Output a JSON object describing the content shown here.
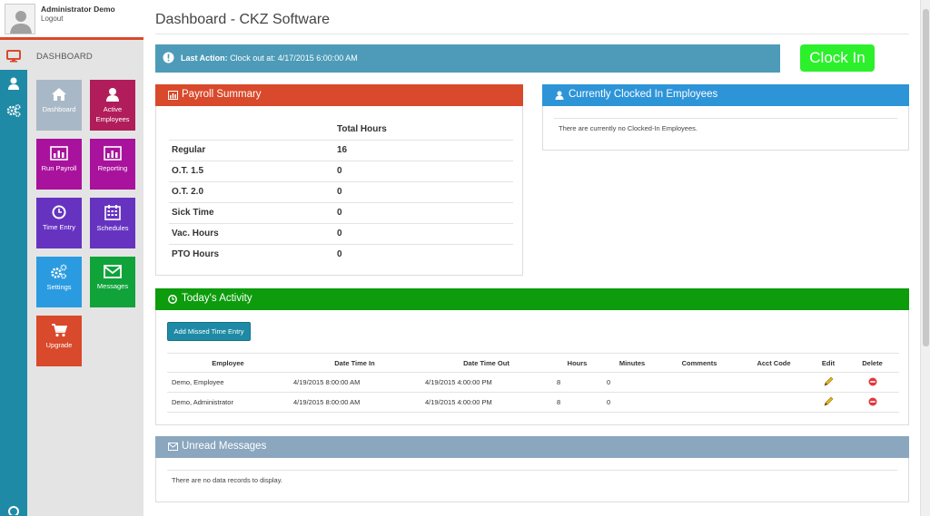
{
  "user": {
    "name": "Administrator Demo",
    "logout_label": "Logout"
  },
  "nav": {
    "dashboard_label": "DASHBOARD"
  },
  "tiles": [
    {
      "label": "Dashboard",
      "icon": "home-icon",
      "color": "#a9b8c6"
    },
    {
      "label": "Active Employees",
      "icon": "user-icon",
      "color": "#b01d5a"
    },
    {
      "label": "Run Payroll",
      "icon": "bar-chart-icon",
      "color": "#a8129c"
    },
    {
      "label": "Reporting",
      "icon": "bar-chart-icon",
      "color": "#a8129c"
    },
    {
      "label": "Time Entry",
      "icon": "clock-icon",
      "color": "#6633c1"
    },
    {
      "label": "Schedules",
      "icon": "calendar-icon",
      "color": "#6633c1"
    },
    {
      "label": "Settings",
      "icon": "gears-icon",
      "color": "#2a9be0"
    },
    {
      "label": "Messages",
      "icon": "envelope-icon",
      "color": "#0fa33a"
    },
    {
      "label": "Upgrade",
      "icon": "cart-icon",
      "color": "#d9492b"
    }
  ],
  "header": {
    "title": "Dashboard - CKZ Software"
  },
  "last_action": {
    "label": "Last Action:",
    "text": "Clock out at: 4/17/2015 6:00:00 AM",
    "color": "#4d9bb8"
  },
  "clock_in": {
    "label": "Clock In",
    "color": "#2cf02c"
  },
  "payroll_summary": {
    "title": "Payroll Summary",
    "color": "#d9492b",
    "column_header": "Total Hours",
    "rows": [
      {
        "label": "Regular",
        "value": "16"
      },
      {
        "label": "O.T. 1.5",
        "value": "0"
      },
      {
        "label": "O.T. 2.0",
        "value": "0"
      },
      {
        "label": "Sick Time",
        "value": "0"
      },
      {
        "label": "Vac. Hours",
        "value": "0"
      },
      {
        "label": "PTO Hours",
        "value": "0"
      }
    ]
  },
  "clocked_in": {
    "title": "Currently Clocked In Employees",
    "color": "#2d94d8",
    "empty_text": "There are currently no Clocked-In Employees."
  },
  "activity": {
    "title": "Today's Activity",
    "color": "#0c9c0c",
    "add_button": "Add Missed Time Entry",
    "columns": [
      "Employee",
      "Date Time In",
      "Date Time Out",
      "Hours",
      "Minutes",
      "Comments",
      "Acct Code",
      "Edit",
      "Delete"
    ],
    "rows": [
      {
        "employee": "Demo, Employee",
        "time_in": "4/19/2015 8:00:00 AM",
        "time_out": "4/19/2015 4:00:00 PM",
        "hours": "8",
        "minutes": "0",
        "comments": "",
        "acct_code": ""
      },
      {
        "employee": "Demo, Administrator",
        "time_in": "4/19/2015 8:00:00 AM",
        "time_out": "4/19/2015 4:00:00 PM",
        "hours": "8",
        "minutes": "0",
        "comments": "",
        "acct_code": ""
      }
    ]
  },
  "messages": {
    "title": "Unread Messages",
    "color": "#8aa7bf",
    "empty_text": "There are no data records to display."
  }
}
